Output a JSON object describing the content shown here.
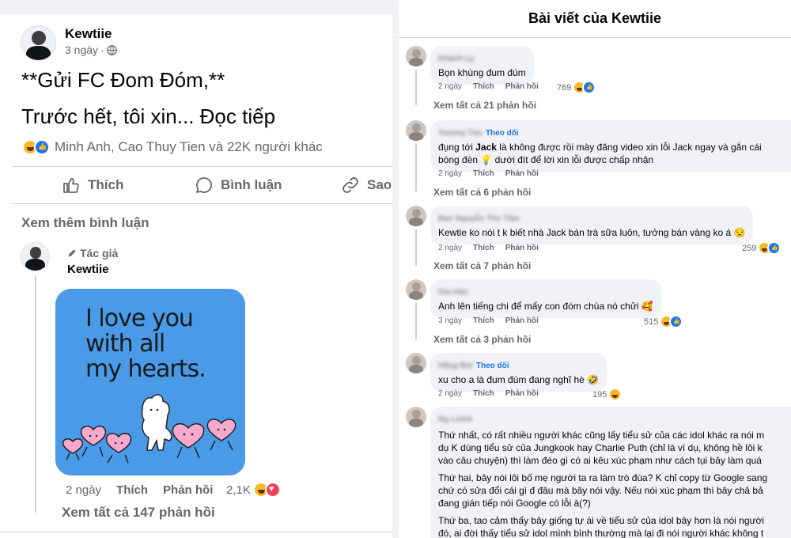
{
  "post": {
    "author": "Kewtiie",
    "time": "3 ngày",
    "line1": "**Gửi FC Đom Đóm,**",
    "line2": "Trước hết, tôi xin... Đọc tiếp",
    "reactions_text": "Minh Anh, Cao Thuy Tien và 22K người khác",
    "actions": {
      "like": "Thích",
      "comment": "Bình luận",
      "share": "Sao"
    },
    "more_comments": "Xem thêm bình luận"
  },
  "author_comment": {
    "badge": "Tác giả",
    "author": "Kewtiie",
    "sticker_text": "I love you\nwith all\nmy hearts.",
    "time": "2 ngày",
    "like": "Thích",
    "reply": "Phản hồi",
    "reaction_count": "2,1K",
    "view_replies": "Xem tất cả 147 phản hồi"
  },
  "panel": {
    "title": "Bài viết của Kewtiie",
    "comments": [
      {
        "name": "Khánh Ly",
        "text": "Bọn khùng đum đúm",
        "time": "2 ngày",
        "like": "Thích",
        "reply": "Phản hồi",
        "count": "769",
        "view": "Xem tất cả 21 phản hồi"
      },
      {
        "name": "Tommy Tùn",
        "follow": "Theo dõi",
        "text_pre": "đụng tới ",
        "text_bold": "Jack",
        "text_post": " là không được rồi mày đăng video xin lỗi Jack ngay và gắn cái",
        "text_line2": "bóng đèn 💡 dưới đít để lời xin lỗi được chấp nhận",
        "time": "2 ngày",
        "like": "Thích",
        "reply": "Phản hồi",
        "view": "Xem tất cả 6 phản hồi"
      },
      {
        "name": "Đan Nguyễn Thu Tâm",
        "text": "Kewtie ko nói t k biết nhà Jack bán trà sữa luôn, tưởng bán vàng ko á 😒",
        "time": "2 ngày",
        "like": "Thích",
        "reply": "Phản hồi",
        "count": "259",
        "view": "Xem tất cả 7 phản hồi"
      },
      {
        "name": "Gia Hân",
        "text": "Anh lên tiếng chi để mấy con đóm chúa nó chửi 🥰",
        "time": "3 ngày",
        "like": "Thích",
        "reply": "Phản hồi",
        "count": "515",
        "view": "Xem tất cả 3 phản hồi"
      },
      {
        "name": "Hằng Bùi",
        "follow": "Theo dõi",
        "text": "xu cho a là đum đúm đang nghĩ hè 🤣",
        "time": "2 ngày",
        "like": "Thích",
        "reply": "Phản hồi",
        "count": "195"
      },
      {
        "name": "Ng Linhh",
        "paragraphs": [
          "Thứ nhất, có rất nhiều người khác cũng lấy tiểu sử của các idol khác ra nói m",
          "dụ K dùng tiểu sử của Jungkook hay Charlie Puth (chỉ là ví dụ, không hề lôi k",
          "vào câu chuyện) thì làm đéo gì có ai kêu xúc phạm như cách tụi bây làm quá",
          "Thứ hai, bây nói lôi bố mẹ người ta ra làm trò đùa? K chỉ copy từ Google sang",
          "chứ có sửa đổi cái gì đ đâu mà bây nói vậy. Nếu nói xúc phạm thì bây chả bả",
          "đang gián tiếp nói Google có lỗi à(?)",
          "Thứ ba, tao cảm thấy bây giống tự ái về tiểu sử của idol bây hơn là nói người",
          "đó, ai đời thấy tiểu sử idol mình bình thường mà lại đi nói người khác không t"
        ]
      }
    ]
  },
  "colors": {
    "accent": "#1877f2",
    "secondary_text": "#65676b",
    "bubble": "#f0f2f5",
    "sticker_bg": "#4a9ae8"
  }
}
